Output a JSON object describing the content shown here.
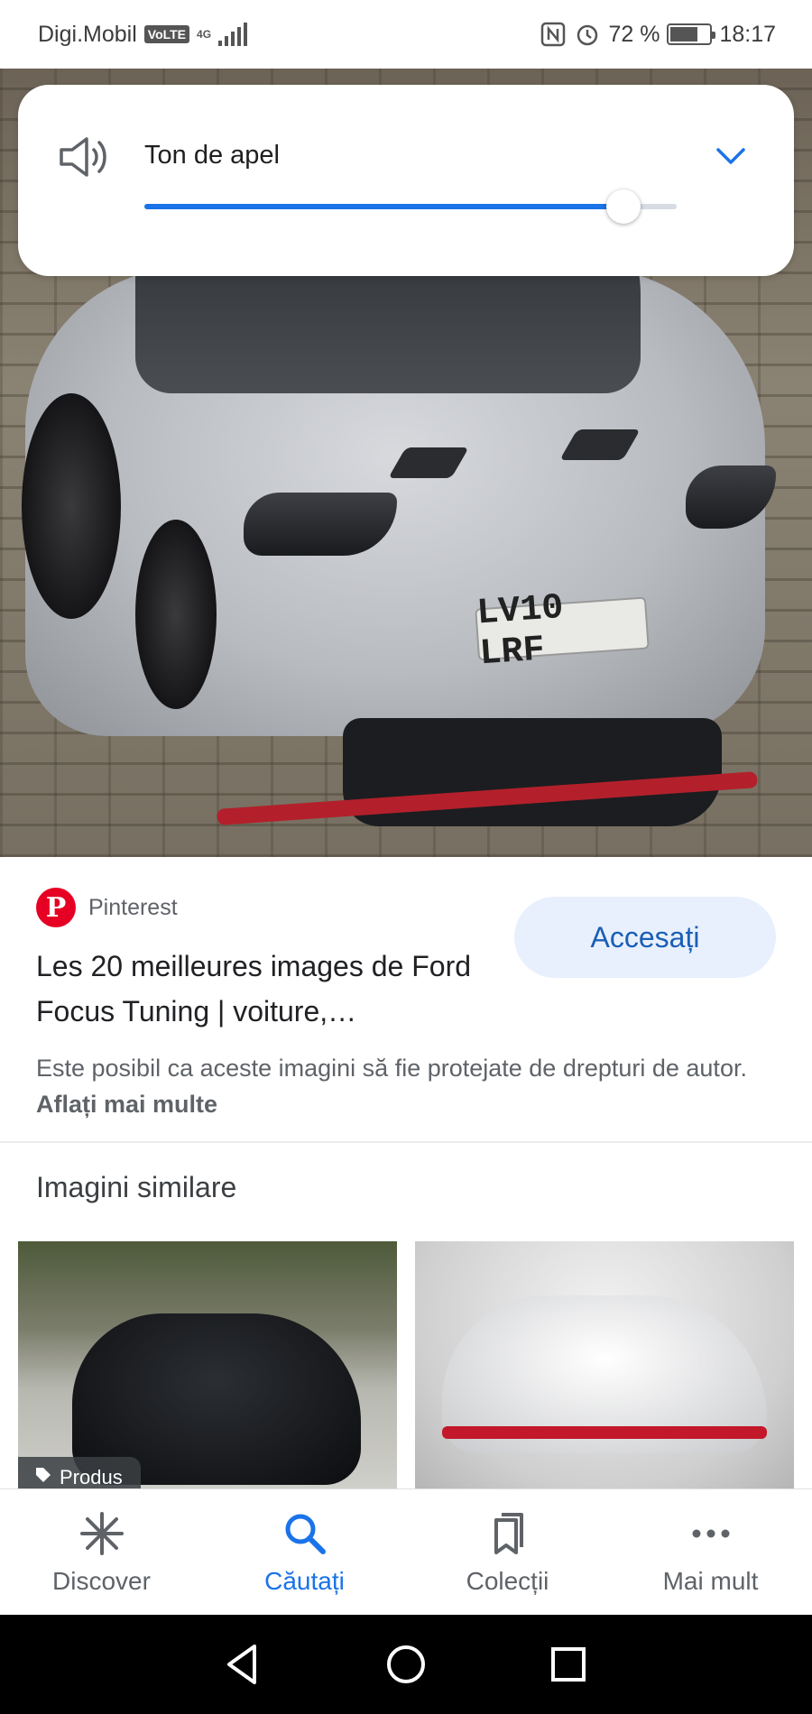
{
  "status_bar": {
    "carrier": "Digi.Mobil",
    "volte": "VoLTE",
    "network": "4G",
    "battery": "72 %",
    "battery_level": 0.72,
    "time": "18:17"
  },
  "hero": {
    "plate_text": "LV10 LRF",
    "notification_count": "1"
  },
  "volume_panel": {
    "label": "Ton de apel",
    "level": 0.9,
    "accent_color": "#1a73e8",
    "icon": "speaker-icon",
    "expand_icon": "chevron-down-icon"
  },
  "result": {
    "source": "Pinterest",
    "title": "Les 20 meilleures images de Ford Focus Tuning | voiture,…",
    "visit_label": "Accesați",
    "copyright_text": "Este posibil ca aceste imagini să fie protejate de drepturi de autor.",
    "learn_more": "Aflați mai multe"
  },
  "similar": {
    "title": "Imagini similare",
    "items": [
      {
        "badge": "Produs",
        "icon": "tag-icon"
      },
      {}
    ]
  },
  "bottom_nav": {
    "items": [
      {
        "label": "Discover",
        "icon": "asterisk-icon",
        "active": false
      },
      {
        "label": "Căutați",
        "icon": "search-icon",
        "active": true
      },
      {
        "label": "Colecții",
        "icon": "bookmarks-icon",
        "active": false
      },
      {
        "label": "Mai mult",
        "icon": "more-icon",
        "active": false
      }
    ]
  },
  "system_nav": {
    "buttons": [
      "back-icon",
      "home-icon",
      "recents-icon"
    ]
  }
}
